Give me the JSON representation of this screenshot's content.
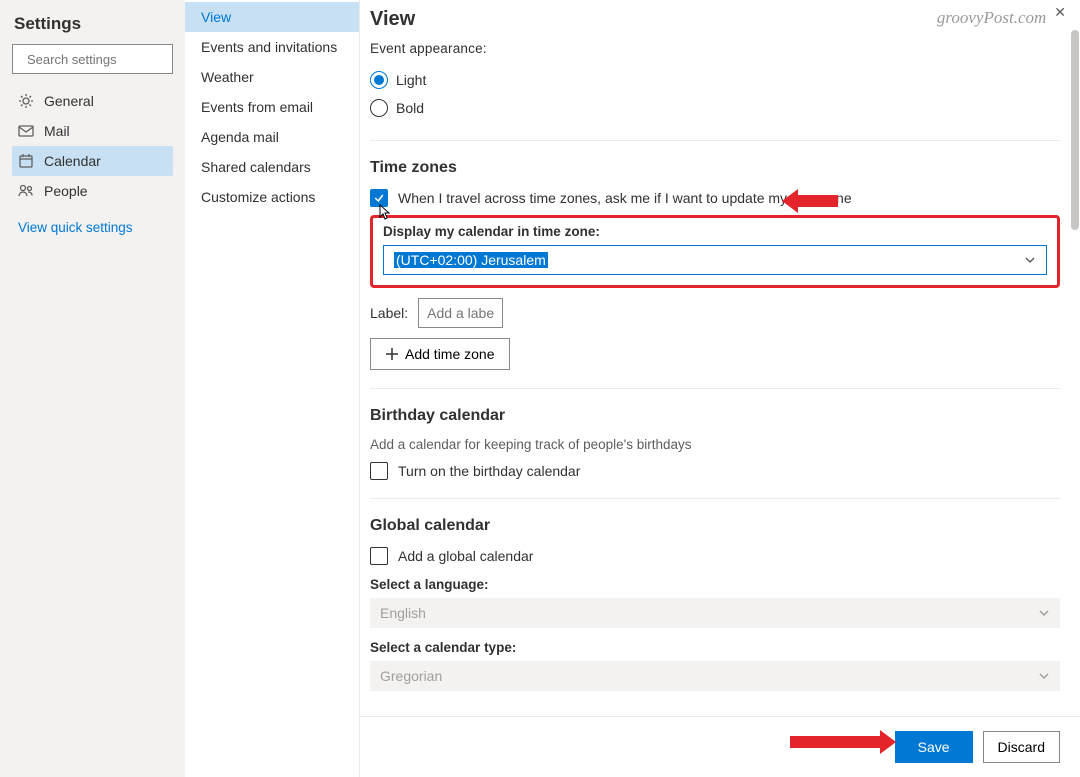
{
  "sidebar": {
    "title": "Settings",
    "searchPlaceholder": "Search settings",
    "nav": [
      {
        "key": "general",
        "label": "General"
      },
      {
        "key": "mail",
        "label": "Mail"
      },
      {
        "key": "calendar",
        "label": "Calendar"
      },
      {
        "key": "people",
        "label": "People"
      }
    ],
    "activeKey": "calendar",
    "quickLink": "View quick settings"
  },
  "subnav": {
    "items": [
      "View",
      "Events and invitations",
      "Weather",
      "Events from email",
      "Agenda mail",
      "Shared calendars",
      "Customize actions"
    ],
    "activeIndex": 0
  },
  "main": {
    "title": "View",
    "watermark": "groovyPost.com",
    "eventAppearance": {
      "heading": "Event appearance:",
      "options": [
        "Light",
        "Bold"
      ],
      "selected": "Light"
    },
    "timezones": {
      "heading": "Time zones",
      "travelCheckLabel": "When I travel across time zones, ask me if I want to update my time zone",
      "travelChecked": true,
      "displayLabel": "Display my calendar in time zone:",
      "selectedTimezone": "(UTC+02:00) Jerusalem",
      "labelFieldLabel": "Label:",
      "labelPlaceholder": "Add a label",
      "addButton": "Add time zone"
    },
    "birthday": {
      "heading": "Birthday calendar",
      "desc": "Add a calendar for keeping track of people's birthdays",
      "checkLabel": "Turn on the birthday calendar",
      "checked": false
    },
    "global": {
      "heading": "Global calendar",
      "checkLabel": "Add a global calendar",
      "checked": false,
      "langLabel": "Select a language:",
      "langValue": "English",
      "calTypeLabel": "Select a calendar type:",
      "calTypeValue": "Gregorian"
    },
    "footer": {
      "save": "Save",
      "discard": "Discard"
    }
  }
}
